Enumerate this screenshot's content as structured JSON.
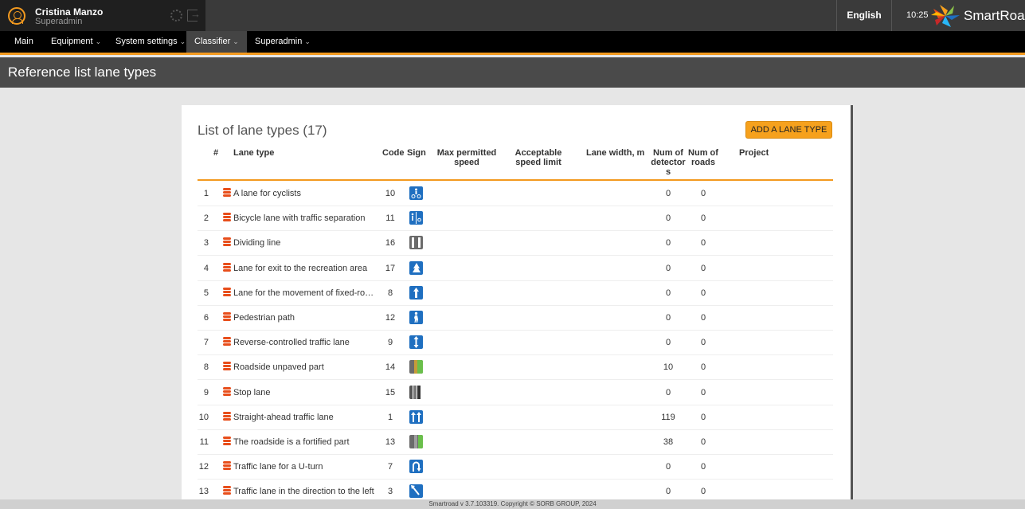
{
  "user": {
    "name": "Cristina Manzo",
    "role": "Superadmin"
  },
  "header": {
    "language": "English",
    "time": "10:25",
    "brand": "SmartRoad"
  },
  "nav": [
    {
      "label": "Main",
      "has_menu": false
    },
    {
      "label": "Equipment",
      "has_menu": true
    },
    {
      "label": "System settings",
      "has_menu": true
    },
    {
      "label": "Classifier",
      "has_menu": true,
      "active": true
    },
    {
      "label": "Superadmin",
      "has_menu": true
    }
  ],
  "page": {
    "title": "Reference list lane types"
  },
  "list": {
    "title": "List of lane types (17)",
    "add_button": "ADD A LANE TYPE",
    "columns": {
      "num": "#",
      "lane_type": "Lane type",
      "code": "Code",
      "sign": "Sign",
      "max_speed": "Max permitted speed",
      "acceptable_speed": "Acceptable speed limit",
      "lane_width": "Lane width, m",
      "num_detectors": "Num of detectors",
      "num_roads": "Num of roads",
      "project": "Project"
    },
    "rows": [
      {
        "num": "1",
        "name": "A lane for cyclists",
        "code": "10",
        "sign": "cyclist-lane-sign",
        "detectors": "0",
        "roads": "0"
      },
      {
        "num": "2",
        "name": "Bicycle lane with traffic separation",
        "code": "11",
        "sign": "bicycle-separation-sign",
        "detectors": "0",
        "roads": "0"
      },
      {
        "num": "3",
        "name": "Dividing line",
        "code": "16",
        "sign": "dividing-line-sign",
        "detectors": "0",
        "roads": "0"
      },
      {
        "num": "4",
        "name": "Lane for exit to the recreation area",
        "code": "17",
        "sign": "recreation-exit-sign",
        "detectors": "0",
        "roads": "0"
      },
      {
        "num": "5",
        "name": "Lane for the movement of fixed-rout...",
        "code": "8",
        "sign": "fixed-route-sign",
        "detectors": "0",
        "roads": "0"
      },
      {
        "num": "6",
        "name": "Pedestrian path",
        "code": "12",
        "sign": "pedestrian-sign",
        "detectors": "0",
        "roads": "0"
      },
      {
        "num": "7",
        "name": "Reverse-controlled traffic lane",
        "code": "9",
        "sign": "reverse-lane-sign",
        "detectors": "0",
        "roads": "0"
      },
      {
        "num": "8",
        "name": "Roadside unpaved part",
        "code": "14",
        "sign": "unpaved-roadside-sign",
        "detectors": "10",
        "roads": "0"
      },
      {
        "num": "9",
        "name": "Stop lane",
        "code": "15",
        "sign": "stop-lane-sign",
        "detectors": "0",
        "roads": "0"
      },
      {
        "num": "10",
        "name": "Straight-ahead traffic lane",
        "code": "1",
        "sign": "straight-ahead-sign",
        "detectors": "119",
        "roads": "0"
      },
      {
        "num": "11",
        "name": "The roadside is a fortified part",
        "code": "13",
        "sign": "fortified-roadside-sign",
        "detectors": "38",
        "roads": "0"
      },
      {
        "num": "12",
        "name": "Traffic lane for a U-turn",
        "code": "7",
        "sign": "u-turn-sign",
        "detectors": "0",
        "roads": "0"
      },
      {
        "num": "13",
        "name": "Traffic lane in the direction to the left",
        "code": "3",
        "sign": "left-turn-sign",
        "detectors": "0",
        "roads": "0"
      }
    ]
  },
  "footer": {
    "text": "Smartroad v 3.7.103319. Copyright © SORB GROUP, 2024"
  },
  "colors": {
    "accent": "#f39a1f",
    "sign_blue": "#1f6fc0",
    "db_icon": "#e84e1b"
  }
}
